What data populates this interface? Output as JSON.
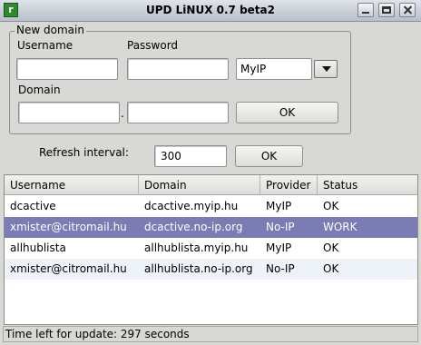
{
  "window": {
    "title": "UPD LiNUX 0.7 beta2",
    "icon_glyph": "r"
  },
  "new_domain": {
    "group_title": "New domain",
    "username_label": "Username",
    "password_label": "Password",
    "domain_label": "Domain",
    "separator": ".",
    "username_value": "",
    "password_value": "",
    "domain_value": "",
    "domain_suffix_value": "",
    "provider_selected": "MyIP",
    "ok_label": "OK"
  },
  "refresh": {
    "label": "Refresh interval:",
    "value": "300",
    "ok_label": "OK"
  },
  "table": {
    "columns": [
      "Username",
      "Domain",
      "Provider",
      "Status"
    ],
    "rows": [
      {
        "username": "dcactive",
        "domain": "dcactive.myip.hu",
        "provider": "MyIP",
        "status": "OK"
      },
      {
        "username": "xmister@citromail.hu",
        "domain": "dcactive.no-ip.org",
        "provider": "No-IP",
        "status": "WORK"
      },
      {
        "username": "allhublista",
        "domain": "allhublista.myip.hu",
        "provider": "MyIP",
        "status": "OK"
      },
      {
        "username": "xmister@citromail.hu",
        "domain": "allhublista.no-ip.org",
        "provider": "No-IP",
        "status": "OK"
      }
    ]
  },
  "status_bar": {
    "text": "Time left for update: 297 seconds"
  },
  "colors": {
    "selection": "#7a7cb3",
    "alt_row": "#eef3fa"
  }
}
